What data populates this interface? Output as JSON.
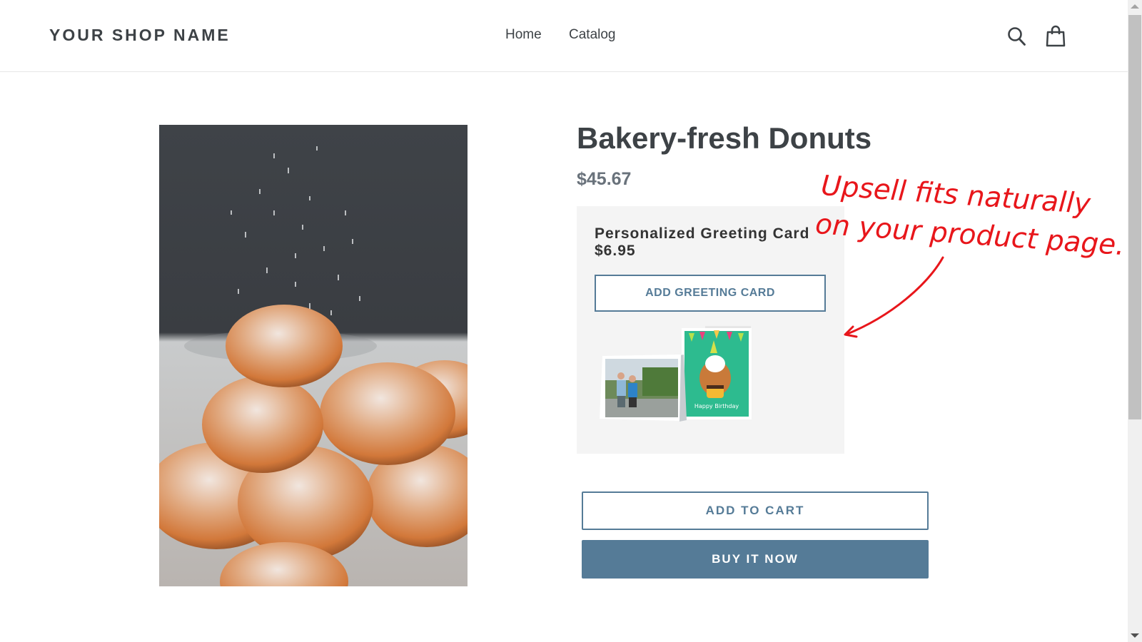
{
  "header": {
    "shop_name": "YOUR SHOP NAME",
    "nav": [
      {
        "label": "Home"
      },
      {
        "label": "Catalog"
      }
    ],
    "icons": {
      "search": "search-icon",
      "cart": "shopping-bag-icon"
    }
  },
  "product": {
    "title": "Bakery-fresh Donuts",
    "price": "$45.67",
    "image_alt": "Powdered sugar falling on stacked donuts"
  },
  "upsell": {
    "name": "Personalized Greeting Card",
    "price": "$6.95",
    "button_label": "ADD GREETING CARD",
    "card_text": "Happy Birthday"
  },
  "actions": {
    "add_to_cart": "ADD TO CART",
    "buy_now": "BUY IT NOW"
  },
  "annotation": {
    "line1": "Upsell fits naturally",
    "line2": "on your product page."
  },
  "colors": {
    "accent": "#557b97",
    "annotation": "#e8161b",
    "upsell_bg": "#f4f4f4",
    "text": "#3d4246"
  }
}
